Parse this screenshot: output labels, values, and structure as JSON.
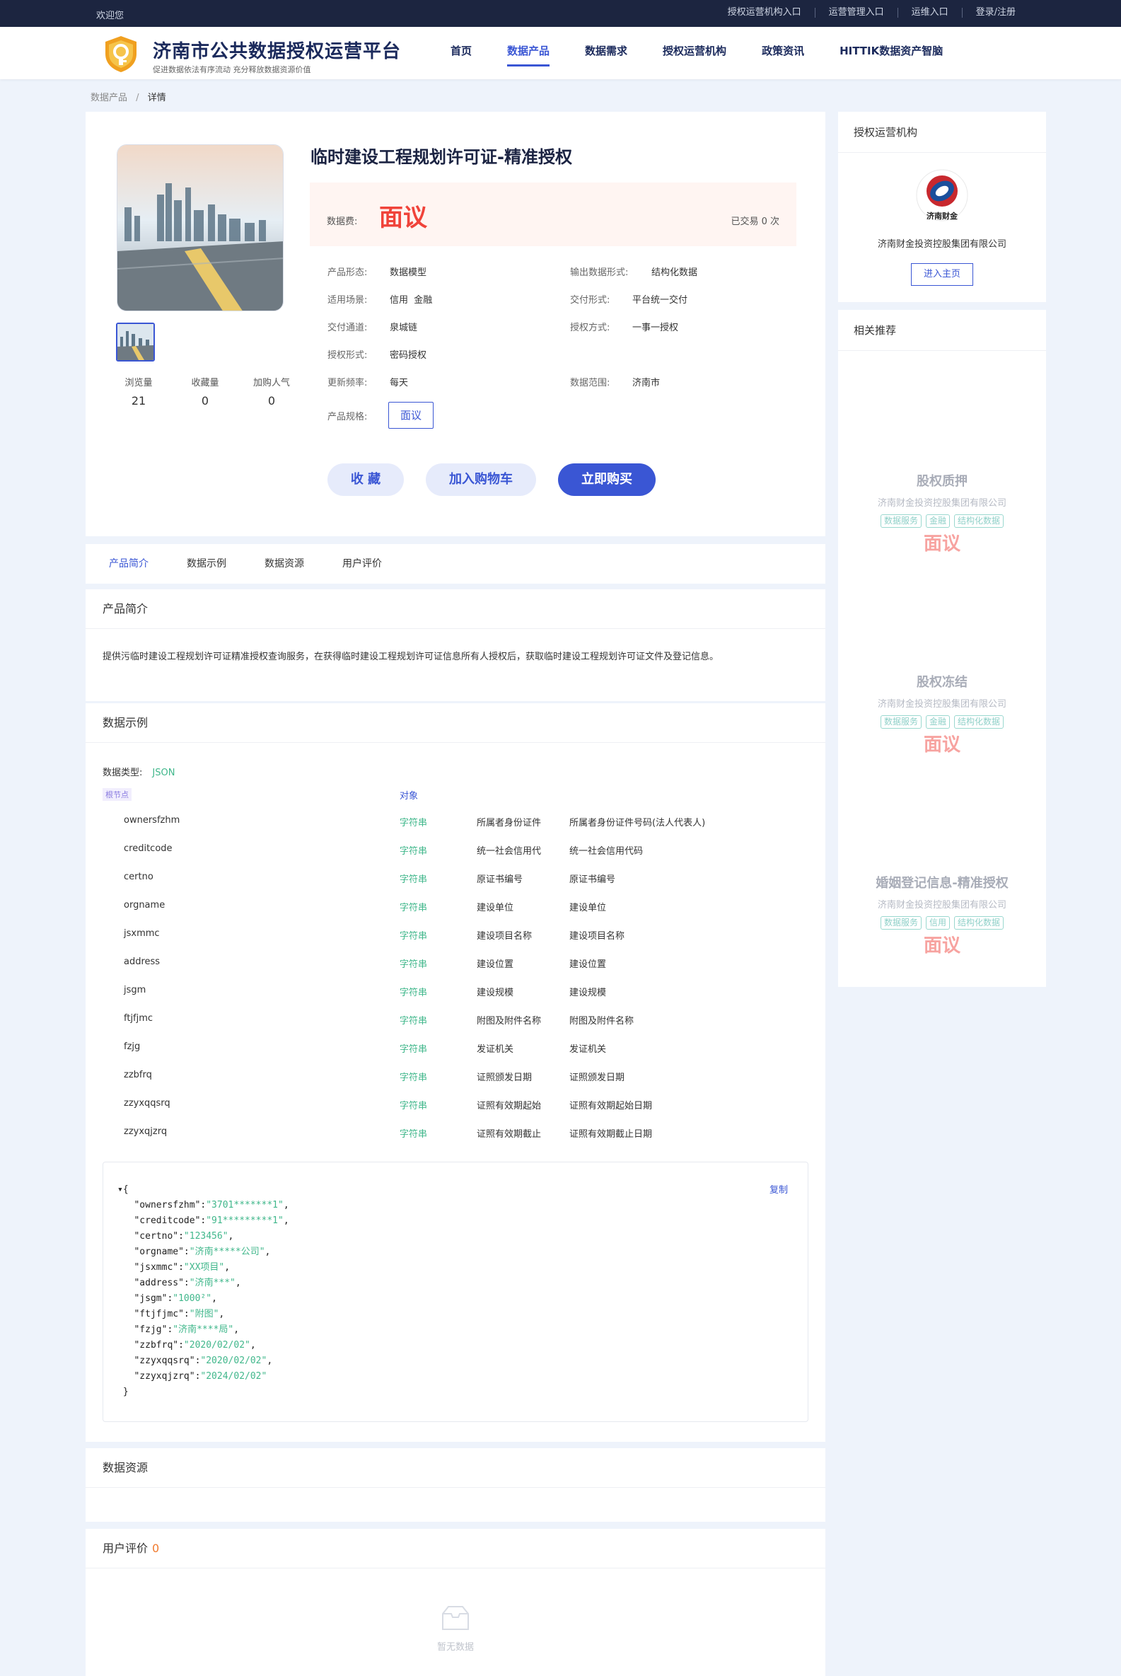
{
  "topbar": {
    "welcome": "欢迎您",
    "links": [
      "授权运营机构入口",
      "运营管理入口",
      "运维入口",
      "登录/注册"
    ]
  },
  "header": {
    "title": "济南市公共数据授权运营平台",
    "subtitle": "促进数据依法有序流动 充分释放数据资源价值",
    "nav": [
      "首页",
      "数据产品",
      "数据需求",
      "授权运营机构",
      "政策资讯",
      "HITTIK数据资产智脑"
    ],
    "active_nav": "数据产品",
    "brand_color": "#3a56d4"
  },
  "breadcrumb": {
    "parent": "数据产品",
    "separator": "/",
    "current": "详情"
  },
  "product": {
    "title": "临时建设工程规划许可证-精准授权",
    "price_label": "数据费:",
    "price_value": "面议",
    "trade_text": "已交易 0 次",
    "stats": [
      {
        "label": "浏览量",
        "value": "21"
      },
      {
        "label": "收藏量",
        "value": "0"
      },
      {
        "label": "加购人气",
        "value": "0"
      }
    ],
    "attrs": {
      "form_label": "产品形态:",
      "form_value": "数据模型",
      "output_label": "输出数据形式:",
      "output_value": "结构化数据",
      "scene_label": "适用场景:",
      "scene_value": "信用  金融",
      "delivery_label": "交付形式:",
      "delivery_value": "平台统一交付",
      "channel_label": "交付通道:",
      "channel_value": "泉城链",
      "auth_label": "授权方式:",
      "auth_value": "一事一授权",
      "authform_label": "授权形式:",
      "authform_value": "密码授权",
      "freq_label": "更新频率:",
      "freq_value": "每天",
      "range_label": "数据范围:",
      "range_value": "济南市",
      "spec_label": "产品规格:",
      "spec_value": "面议"
    },
    "buttons": {
      "favorite": "收 藏",
      "cart": "加入购物车",
      "buy": "立即购买"
    }
  },
  "tabs": [
    "产品简介",
    "数据示例",
    "数据资源",
    "用户评价"
  ],
  "intro": {
    "heading": "产品简介",
    "text": "提供污临时建设工程规划许可证精准授权查询服务，在获得临时建设工程规划许可证信息所有人授权后，获取临时建设工程规划许可证文件及登记信息。"
  },
  "example": {
    "heading": "数据示例",
    "type_label": "数据类型:",
    "type_value": "JSON",
    "root_tag": "根节点",
    "root_type": "对象",
    "fields": [
      {
        "name": "ownersfzhm",
        "type": "字符串",
        "desc": "所属者身份证件",
        "full": "所属者身份证件号码(法人代表人)"
      },
      {
        "name": "creditcode",
        "type": "字符串",
        "desc": "统一社会信用代",
        "full": "统一社会信用代码"
      },
      {
        "name": "certno",
        "type": "字符串",
        "desc": "原证书编号",
        "full": "原证书编号"
      },
      {
        "name": "orgname",
        "type": "字符串",
        "desc": "建设单位",
        "full": "建设单位"
      },
      {
        "name": "jsxmmc",
        "type": "字符串",
        "desc": "建设项目名称",
        "full": "建设项目名称"
      },
      {
        "name": "address",
        "type": "字符串",
        "desc": "建设位置",
        "full": "建设位置"
      },
      {
        "name": "jsgm",
        "type": "字符串",
        "desc": "建设规模",
        "full": "建设规模"
      },
      {
        "name": "ftjfjmc",
        "type": "字符串",
        "desc": "附图及附件名称",
        "full": "附图及附件名称"
      },
      {
        "name": "fzjg",
        "type": "字符串",
        "desc": "发证机关",
        "full": "发证机关"
      },
      {
        "name": "zzbfrq",
        "type": "字符串",
        "desc": "证照颁发日期",
        "full": "证照颁发日期"
      },
      {
        "name": "zzyxqqsrq",
        "type": "字符串",
        "desc": "证照有效期起始",
        "full": "证照有效期起始日期"
      },
      {
        "name": "zzyxqjzrq",
        "type": "字符串",
        "desc": "证照有效期截止",
        "full": "证照有效期截止日期"
      }
    ],
    "copy_label": "复制",
    "json_sample": [
      {
        "key": "ownersfzhm",
        "value": "3701*******1"
      },
      {
        "key": "creditcode",
        "value": "91*********1"
      },
      {
        "key": "certno",
        "value": "123456"
      },
      {
        "key": "orgname",
        "value": "济南*****公司"
      },
      {
        "key": "jsxmmc",
        "value": "XX项目"
      },
      {
        "key": "address",
        "value": "济南***"
      },
      {
        "key": "jsgm",
        "value": "1000²"
      },
      {
        "key": "ftjfjmc",
        "value": "附图"
      },
      {
        "key": "fzjg",
        "value": "济南****局"
      },
      {
        "key": "zzbfrq",
        "value": "2020/02/02"
      },
      {
        "key": "zzyxqqsrq",
        "value": "2020/02/02"
      },
      {
        "key": "zzyxqjzrq",
        "value": "2024/02/02"
      }
    ]
  },
  "resource": {
    "heading": "数据资源"
  },
  "review": {
    "heading": "用户评价",
    "count": "0",
    "empty_text": "暂无数据"
  },
  "org": {
    "heading": "授权运营机构",
    "logo_text": "济南财金",
    "name": "济南财金投资控股集团有限公司",
    "button": "进入主页"
  },
  "recommend": {
    "heading": "相关推荐",
    "items": [
      {
        "title": "股权质押",
        "org": "济南财金投资控股集团有限公司",
        "tags": [
          "数据服务",
          "金融",
          "结构化数据"
        ],
        "price": "面议"
      },
      {
        "title": "股权冻结",
        "org": "济南财金投资控股集团有限公司",
        "tags": [
          "数据服务",
          "金融",
          "结构化数据"
        ],
        "price": "面议"
      },
      {
        "title": "婚姻登记信息-精准授权",
        "org": "济南财金投资控股集团有限公司",
        "tags": [
          "数据服务",
          "信用",
          "结构化数据"
        ],
        "price": "面议"
      }
    ]
  }
}
